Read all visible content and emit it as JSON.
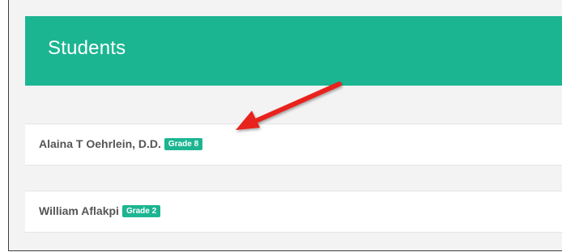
{
  "header": {
    "title": "Students"
  },
  "students": [
    {
      "name": "Alaina T Oehrlein, D.D.",
      "grade": "Grade 8"
    },
    {
      "name": "William Aflakpi",
      "grade": "Grade 2"
    }
  ],
  "colors": {
    "accent": "#1cb592",
    "annotation_arrow": "#e8231f",
    "card_text": "#555555",
    "background": "#f3f3f3"
  },
  "annotations": {
    "arrow_icon": "red-pointer-arrow-icon"
  }
}
